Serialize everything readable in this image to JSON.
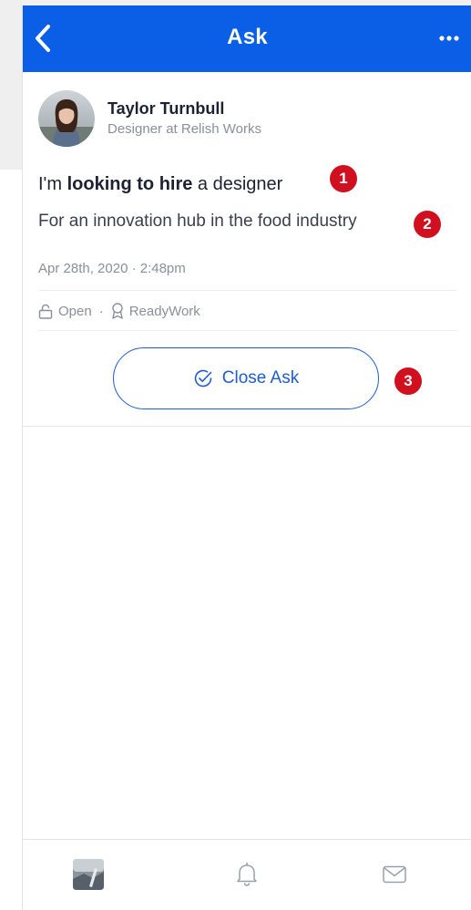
{
  "nav": {
    "title": "Ask",
    "back_icon": "chevron-left-icon",
    "more_icon": "ellipsis-icon"
  },
  "post": {
    "author": {
      "name": "Taylor Turnbull",
      "role": "Designer at Relish Works"
    },
    "headline": {
      "prefix": "I'm ",
      "emphasis": "looking to hire",
      "suffix": " a designer"
    },
    "description": "For an innovation hub in the food industry",
    "timestamp": "Apr 28th, 2020 · 2:48pm",
    "status": "Open",
    "separator": "·",
    "organization": "ReadyWork",
    "close_label": "Close Ask"
  },
  "annotations": [
    "1",
    "2",
    "3"
  ],
  "tabs": [
    {
      "name": "profile-tab",
      "icon": "profile-thumbnail"
    },
    {
      "name": "notifications-tab",
      "icon": "bell-icon"
    },
    {
      "name": "messages-tab",
      "icon": "envelope-icon"
    }
  ],
  "colors": {
    "brand_blue": "#0a5fe6",
    "button_blue": "#1e5dcc",
    "badge_red": "#d0101e",
    "text_dark": "#1d2233",
    "text_muted": "#8a8f99"
  }
}
